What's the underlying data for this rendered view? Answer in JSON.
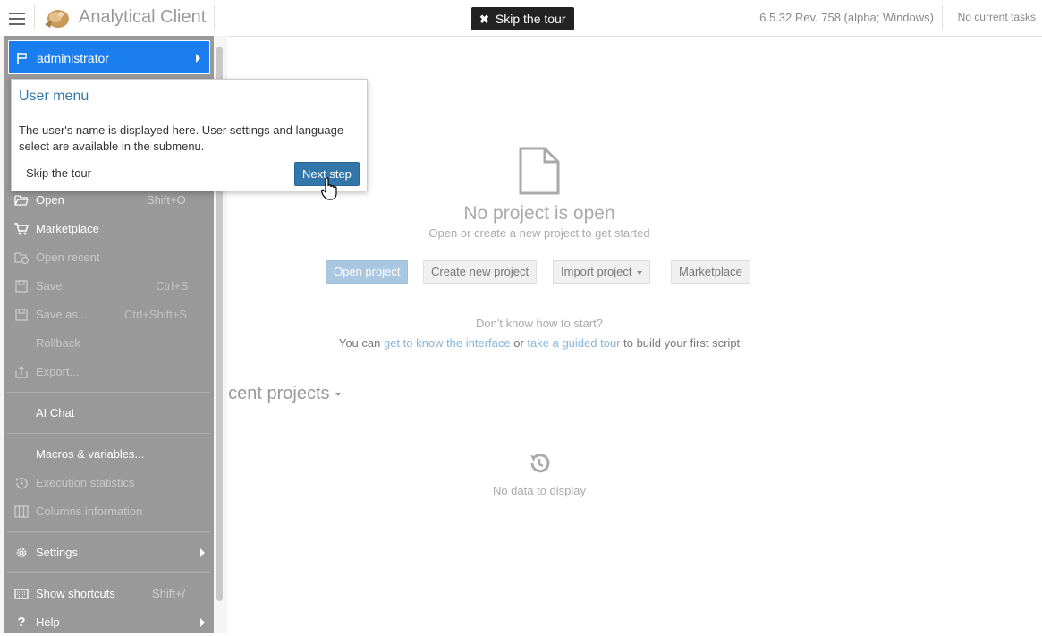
{
  "header": {
    "app_title": "Analytical Client",
    "skip_tour_label": "Skip the tour",
    "version": "6.5.32 Rev. 758 (alpha; Windows)",
    "tasks_status": "No current tasks"
  },
  "main": {
    "empty_title": "No project is open",
    "empty_subtitle": "Open or create a new project to get started",
    "buttons": {
      "open_project": "Open project",
      "create_project": "Create new project",
      "import_project": "Import project",
      "marketplace": "Marketplace"
    },
    "dont_know": "Don't know how to start?",
    "help_prefix": "You can ",
    "help_link1": "get to know the interface",
    "help_mid": " or ",
    "help_link2": "take a guided tour",
    "help_suffix": " to build your first script",
    "recent_title": "ecent projects",
    "no_data": "No data to display"
  },
  "menu": {
    "user": "administrator",
    "items": [
      {
        "label": "Open",
        "shortcut": "Shift+O",
        "icon": "folder-open-icon",
        "enabled": true
      },
      {
        "label": "Marketplace",
        "shortcut": "",
        "icon": "cart-icon",
        "enabled": true
      },
      {
        "label": "Open recent",
        "shortcut": "",
        "icon": "open-recent-icon",
        "enabled": false
      },
      {
        "label": "Save",
        "shortcut": "Ctrl+S",
        "icon": "floppy-icon",
        "enabled": false
      },
      {
        "label": "Save as...",
        "shortcut": "Ctrl+Shift+S",
        "icon": "floppy-icon",
        "enabled": false
      },
      {
        "label": "Rollback",
        "shortcut": "",
        "icon": "",
        "enabled": false
      },
      {
        "label": "Export...",
        "shortcut": "",
        "icon": "export-icon",
        "enabled": false
      },
      {
        "label": "AI Chat",
        "shortcut": "",
        "icon": "",
        "enabled": true
      },
      {
        "label": "Macros & variables...",
        "shortcut": "",
        "icon": "",
        "enabled": true
      },
      {
        "label": "Execution statistics",
        "shortcut": "",
        "icon": "history-icon",
        "enabled": false
      },
      {
        "label": "Columns information",
        "shortcut": "",
        "icon": "columns-icon",
        "enabled": false
      },
      {
        "label": "Settings",
        "shortcut": "",
        "icon": "gear-icon",
        "enabled": true
      },
      {
        "label": "Show shortcuts",
        "shortcut": "Shift+/",
        "icon": "keyboard-icon",
        "enabled": true
      },
      {
        "label": "Help",
        "shortcut": "",
        "icon": "question-icon",
        "enabled": true
      }
    ]
  },
  "tour": {
    "title": "User menu",
    "body": "The user's name is displayed here. User settings and language select are available in the submenu.",
    "skip_label": "Skip the tour",
    "next_label": "Next step"
  }
}
